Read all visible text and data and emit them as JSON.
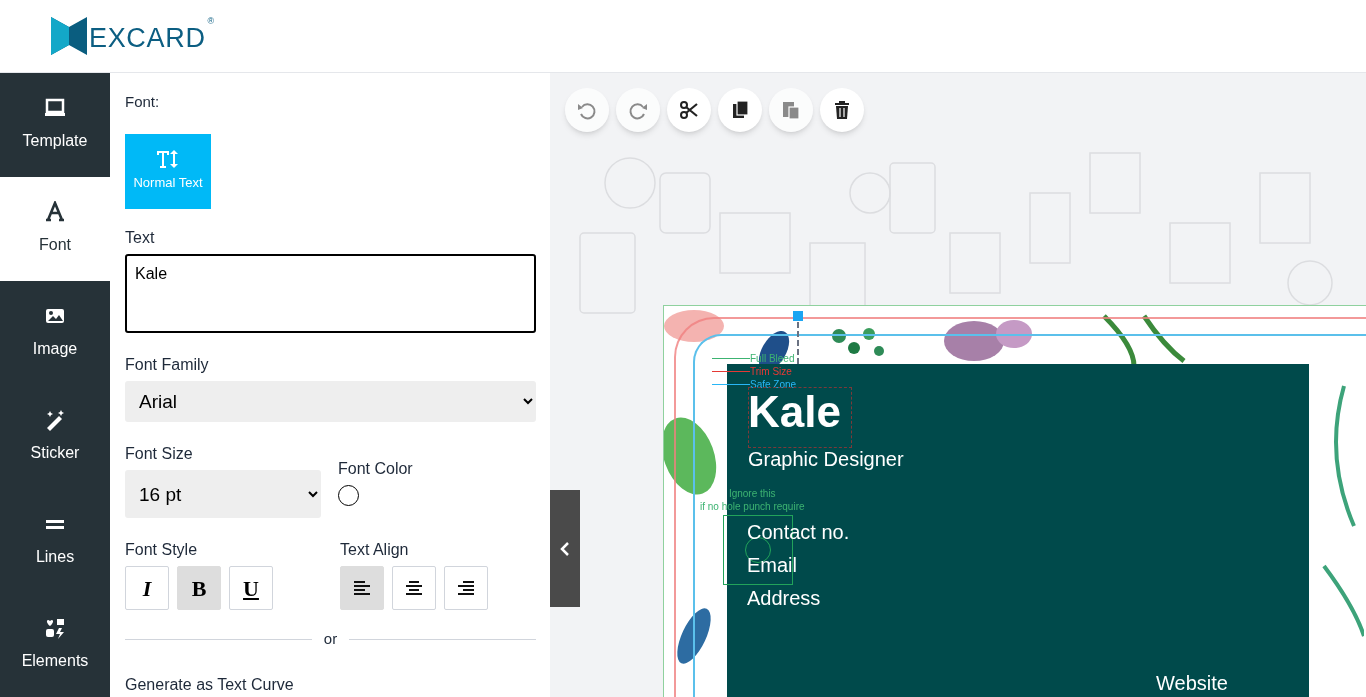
{
  "logo": {
    "text": "EXCARD",
    "mark": "®"
  },
  "sidebar": {
    "items": [
      {
        "label": "Template",
        "kind": "monitor",
        "selected": false
      },
      {
        "label": "Font",
        "kind": "letter",
        "selected": true
      },
      {
        "label": "Image",
        "kind": "image",
        "selected": false
      },
      {
        "label": "Sticker",
        "kind": "wand",
        "selected": false
      },
      {
        "label": "Lines",
        "kind": "lines",
        "selected": false
      },
      {
        "label": "Elements",
        "kind": "shapes",
        "selected": false
      }
    ]
  },
  "panel": {
    "heading": "Font:",
    "text_type_button": {
      "label": "Normal Text"
    },
    "text_field": {
      "label": "Text",
      "value": "Kale"
    },
    "font_family": {
      "label": "Font Family",
      "value": "Arial"
    },
    "font_size": {
      "label": "Font Size",
      "value": "16 pt"
    },
    "font_color": {
      "label": "Font Color"
    },
    "font_style": {
      "label": "Font Style",
      "buttons": [
        {
          "kind": "italic",
          "label": "I",
          "selected": false
        },
        {
          "kind": "bold",
          "label": "B",
          "selected": true
        },
        {
          "kind": "underline",
          "label": "U",
          "selected": false
        }
      ]
    },
    "text_align": {
      "label": "Text Align",
      "buttons": [
        {
          "kind": "left",
          "selected": true
        },
        {
          "kind": "center",
          "selected": false
        },
        {
          "kind": "right",
          "selected": false
        }
      ]
    },
    "divider_text": "or",
    "curve_label": "Generate as Text Curve"
  },
  "toolbar": [
    {
      "kind": "undo",
      "disabled": true
    },
    {
      "kind": "redo",
      "disabled": true
    },
    {
      "kind": "cut",
      "disabled": false
    },
    {
      "kind": "copy",
      "disabled": false
    },
    {
      "kind": "paste",
      "disabled": true
    },
    {
      "kind": "delete",
      "disabled": false
    }
  ],
  "card": {
    "guides": [
      {
        "label": "Full Bleed",
        "color": "#3cb371"
      },
      {
        "label": "Trim Size",
        "color": "#e53935"
      },
      {
        "label": "Safe Zone",
        "color": "#29b6f6"
      }
    ],
    "hole_punch_note": [
      "Ignore this",
      "if no hole punch require"
    ],
    "name": "Kale",
    "title": "Graphic Designer",
    "details": [
      "Contact no.",
      "Email",
      "Address"
    ],
    "website": "Website"
  }
}
